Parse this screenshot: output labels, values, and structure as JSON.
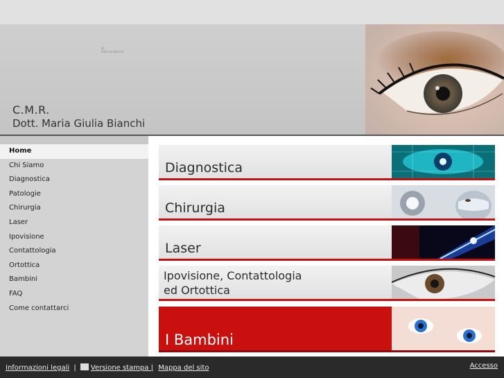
{
  "header": {
    "tiny_line1": "Dr.",
    "tiny_line2": "Dott.ssa Bianchi",
    "brand_line1": "C.M.R.",
    "brand_line2": "Dott. Maria Giulia Bianchi"
  },
  "sidebar": {
    "items": [
      {
        "label": "Home"
      },
      {
        "label": "Chi Siamo"
      },
      {
        "label": "Diagnostica"
      },
      {
        "label": "Patologie"
      },
      {
        "label": "Chirurgia"
      },
      {
        "label": "Laser"
      },
      {
        "label": "Ipovisione"
      },
      {
        "label": "Contattologia"
      },
      {
        "label": "Ortottica"
      },
      {
        "label": "Bambini"
      },
      {
        "label": "FAQ"
      },
      {
        "label": "Come contattarci"
      }
    ]
  },
  "banners": {
    "diagnostica": "Diagnostica",
    "chirurgia": "Chirurgia",
    "laser": "Laser",
    "ipovisione_l1": "Ipovisione, Contattologia",
    "ipovisione_l2": "ed Ortottica",
    "bambini": "I Bambini"
  },
  "footer": {
    "legal": "Informazioni legali",
    "sep": "|",
    "print": "Versione stampa |",
    "sitemap": "Mappa del sito",
    "access": "Accesso"
  },
  "colors": {
    "accent_red": "#c9100f",
    "footer_bg": "#2a2a2a"
  }
}
